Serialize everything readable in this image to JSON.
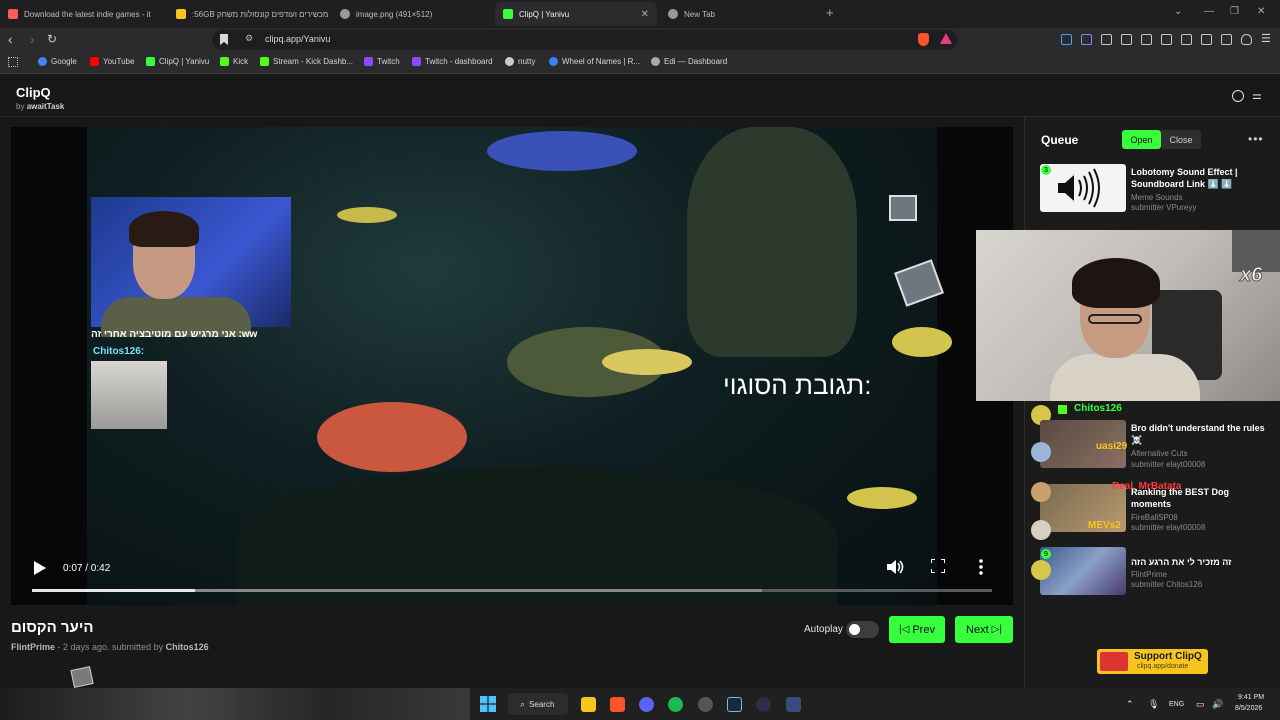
{
  "browser": {
    "tabs": [
      {
        "title": "Download the latest indie games - it",
        "favicon_color": "#fa5c5c"
      },
      {
        "title": ":56GB מכשירים ועודפים קונסולות משחק",
        "favicon_color": "#f7c51f"
      },
      {
        "title": "image.png (491×512)",
        "favicon_color": "#9a9a9a"
      },
      {
        "title": "ClipQ | Yanivu",
        "favicon_color": "#37ff3c"
      },
      {
        "title": "New Tab",
        "favicon_color": "#9a9a9a"
      }
    ],
    "url": "clipq.app/Yanivu",
    "bookmarks": [
      {
        "label": "Google",
        "color": "#4285f4"
      },
      {
        "label": "YouTube",
        "color": "#ff0000"
      },
      {
        "label": "ClipQ | Yanivu",
        "color": "#37ff3c"
      },
      {
        "label": "Kick",
        "color": "#53fc18"
      },
      {
        "label": "Stream - Kick Dashb...",
        "color": "#53fc18"
      },
      {
        "label": "Twitch",
        "color": "#9146ff"
      },
      {
        "label": "Twitch - dashboard",
        "color": "#9146ff"
      },
      {
        "label": "nutty",
        "color": "#cccccc"
      },
      {
        "label": "Wheel of Names | R...",
        "color": "#3b82f6"
      },
      {
        "label": "Edi — Dashboard",
        "color": "#aaaaaa"
      }
    ]
  },
  "app": {
    "name": "ClipQ",
    "by_prefix": "by",
    "by_author": "awaitTask",
    "accent": "#37ff3c"
  },
  "player": {
    "time": "0:07 / 0:42",
    "progress": 0.17,
    "buffered": 0.76,
    "caption": "תגובת הסוגוי:",
    "chat_line_1": "אני מרגיש עם מוטיבציה אחרי זה :ww",
    "chat_line_2": "Chitos126:"
  },
  "clip": {
    "title": "היער הקסום",
    "channel": "FlintPrime",
    "meta": " - 2 days ago. submitted by ",
    "submitter": "Chitos126",
    "autoplay_label": "Autoplay",
    "prev_label": "Prev",
    "next_label": "Next"
  },
  "queue": {
    "title": "Queue",
    "open_label": "Open",
    "close_label": "Close",
    "items": [
      {
        "badge": "3",
        "title": "Lobotomy Sound Effect | Soundboard Link ⬇️ ⬇️",
        "channel": "Meme Sounds",
        "submitter": "submitter VPureyy"
      },
      {
        "title": "Bro didn't understand the rules ☠️",
        "channel": "Alternative Cuts",
        "submitter": "submitter elayt00008"
      },
      {
        "title": "Ranking the BEST Dog moments",
        "channel": "FireBallSP08",
        "submitter": "submitter elayt00008"
      },
      {
        "badge": "9",
        "title": "זה מזכיר לי את הרגע הזה",
        "channel": "FlintPrime",
        "submitter": "submitter Chitos126"
      }
    ],
    "overlay_multiplier": "x6",
    "chat_names": [
      "Chitos126",
      "uasi29",
      "Real_MrBatata",
      "MEVs2"
    ]
  },
  "support": {
    "title": "Support ClipQ",
    "url": "clipq.app/donate"
  },
  "taskbar": {
    "search_label": "Search",
    "lang": "ENG",
    "time": "9:41 PM",
    "date": "8/5/2026"
  }
}
